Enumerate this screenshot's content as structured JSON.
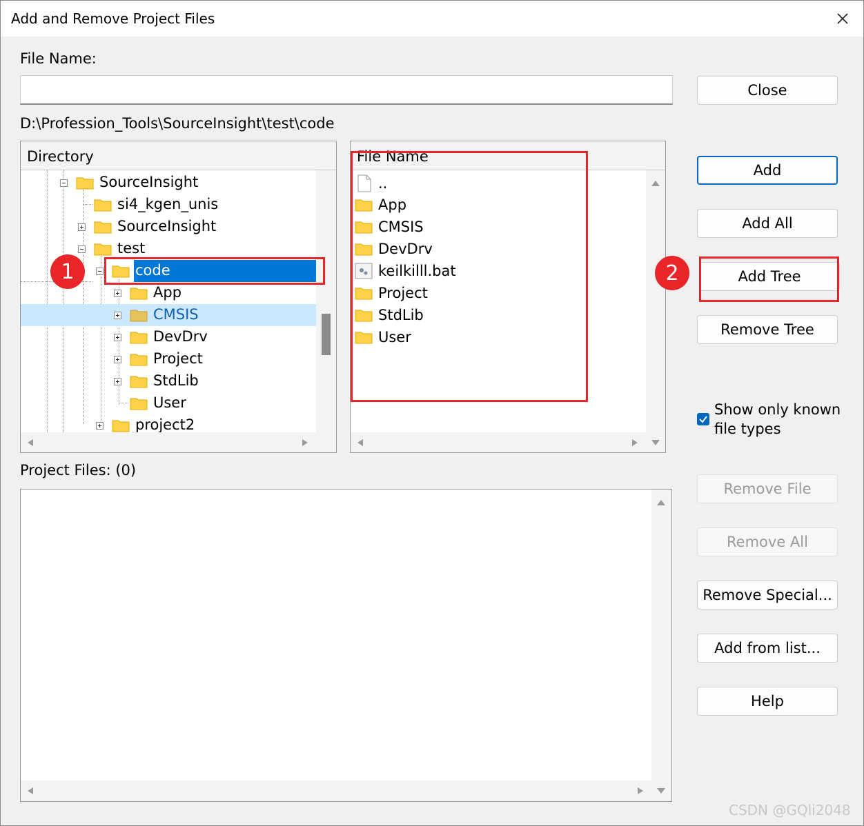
{
  "window": {
    "title": "Add and Remove Project Files"
  },
  "file_name": {
    "label": "File Name:",
    "value": ""
  },
  "current_path": "D:\\Profession_Tools\\SourceInsight\\test\\code",
  "directory_panel": {
    "header": "Directory",
    "items": [
      {
        "label": "SourceInsight"
      },
      {
        "label": "si4_kgen_unis"
      },
      {
        "label": "SourceInsight"
      },
      {
        "label": "test"
      },
      {
        "label": "code"
      },
      {
        "label": "App"
      },
      {
        "label": "CMSIS"
      },
      {
        "label": "DevDrv"
      },
      {
        "label": "Project"
      },
      {
        "label": "StdLib"
      },
      {
        "label": "User"
      },
      {
        "label": "project2"
      }
    ]
  },
  "file_panel": {
    "header": "File Name",
    "items": [
      {
        "label": "..",
        "icon": "blank-file-icon"
      },
      {
        "label": "App",
        "icon": "folder-icon"
      },
      {
        "label": "CMSIS",
        "icon": "folder-icon"
      },
      {
        "label": "DevDrv",
        "icon": "folder-icon"
      },
      {
        "label": "keilkilll.bat",
        "icon": "batch-file-icon"
      },
      {
        "label": "Project",
        "icon": "folder-icon"
      },
      {
        "label": "StdLib",
        "icon": "folder-icon"
      },
      {
        "label": "User",
        "icon": "folder-icon"
      }
    ]
  },
  "project_files": {
    "label": "Project Files: (0)"
  },
  "buttons": {
    "close": "Close",
    "add": "Add",
    "add_all": "Add All",
    "add_tree": "Add Tree",
    "remove_tree": "Remove Tree",
    "remove_file": "Remove File",
    "remove_all": "Remove All",
    "remove_special": "Remove Special...",
    "add_from_list": "Add from list...",
    "help": "Help"
  },
  "checkbox": {
    "label_line1": "Show only known",
    "label_line2": "file types",
    "checked": true
  },
  "annotations": {
    "badge1": "1",
    "badge2": "2"
  },
  "watermark": "CSDN @GQli2048",
  "colors": {
    "accent": "#0067c0",
    "selection": "#0078d7",
    "hover_row": "#cce8ff",
    "annotation_red": "#e8262a",
    "folder_yellow": "#ffd24a"
  }
}
